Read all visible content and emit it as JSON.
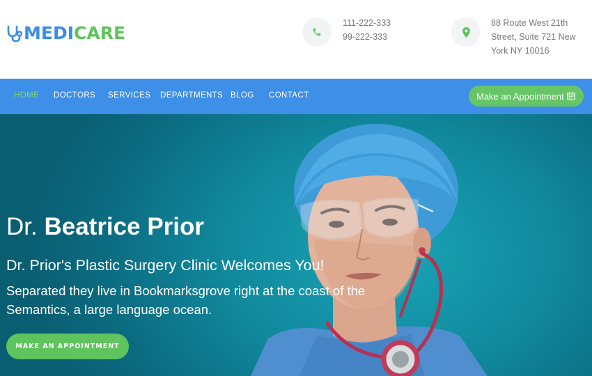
{
  "brand": {
    "name_part1": "MEDI",
    "name_part2": "CARE",
    "icon": "stethoscope-icon"
  },
  "contact": {
    "phone_icon": "phone-icon",
    "phone_lines": [
      "111-222-333",
      "99-222-333"
    ],
    "address_icon": "location-pin-icon",
    "address_lines": [
      "88 Route West 21th",
      "Street, Suite 721 New",
      "York NY 10016"
    ]
  },
  "nav": {
    "items": [
      {
        "label": "HOME",
        "active": true
      },
      {
        "label": "DOCTORS",
        "active": false
      },
      {
        "label": "SERVICES",
        "active": false
      },
      {
        "label": "DEPARTMENTS",
        "active": false
      },
      {
        "label": "BLOG",
        "active": false
      },
      {
        "label": "CONTACT",
        "active": false
      }
    ],
    "cta_label": "Make an Appointment",
    "cta_icon": "calendar-icon"
  },
  "hero": {
    "title_prefix": "Dr. ",
    "title_name": "Beatrice Prior",
    "subtitle": "Dr. Prior's Plastic Surgery Clinic Welcomes You!",
    "description": "Separated they live in Bookmarksgrove right at the coast of the Semantics, a large language ocean.",
    "button_label": "MAKE AN APPOINTMENT"
  },
  "colors": {
    "brand_blue": "#3a8fe5",
    "brand_green": "#5ec55c",
    "nav_bg": "#3d8fe8",
    "hero_teal": "#11899d"
  }
}
